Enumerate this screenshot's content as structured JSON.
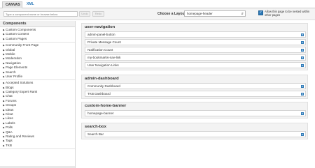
{
  "tabs": [
    {
      "label": "CANVAS"
    },
    {
      "label": "XML"
    }
  ],
  "toolbar": {
    "search_placeholder": "Type a component name or browse below",
    "undo_label": "Undo",
    "redo_label": "Redo",
    "layout_label": "Choose a Layout:",
    "layout_value": "homepage-header",
    "nest_label": "Allow this page to be nested within other pages",
    "nest_checked": true
  },
  "sidebar": {
    "title": "Components",
    "groups": [
      [
        "Custom Components",
        "Custom Content",
        "Custom Pages"
      ],
      [
        "Community Front Page",
        "Global",
        "Mobile",
        "Moderation",
        "Navigation",
        "Page Elements",
        "Search",
        "User Profile"
      ],
      [
        "Accepted Solutions",
        "Blogs",
        "Category Expert Rank",
        "Chat",
        "Forums",
        "Groups",
        "Ideas",
        "Klout",
        "Likes",
        "Labels",
        "Polls",
        "Q&A",
        "Rating and Reviews",
        "Tags",
        "TKB"
      ]
    ]
  },
  "sections": [
    {
      "title": "user-navigation",
      "rows": [
        "admin-panel-button",
        "Private Message Count",
        "Notification Count",
        "my-bookmarks-nav-link",
        "User Navigation Links"
      ]
    },
    {
      "title": "admin-dashboard",
      "rows": [
        "Community Dashboard",
        "TKB Dashboard"
      ]
    },
    {
      "title": "custom-home-banner",
      "rows": [
        "homepage-banner"
      ]
    },
    {
      "title": "search-box",
      "rows": [
        "Search Bar"
      ]
    }
  ],
  "colors": {
    "accent": "#2e7ab8"
  }
}
